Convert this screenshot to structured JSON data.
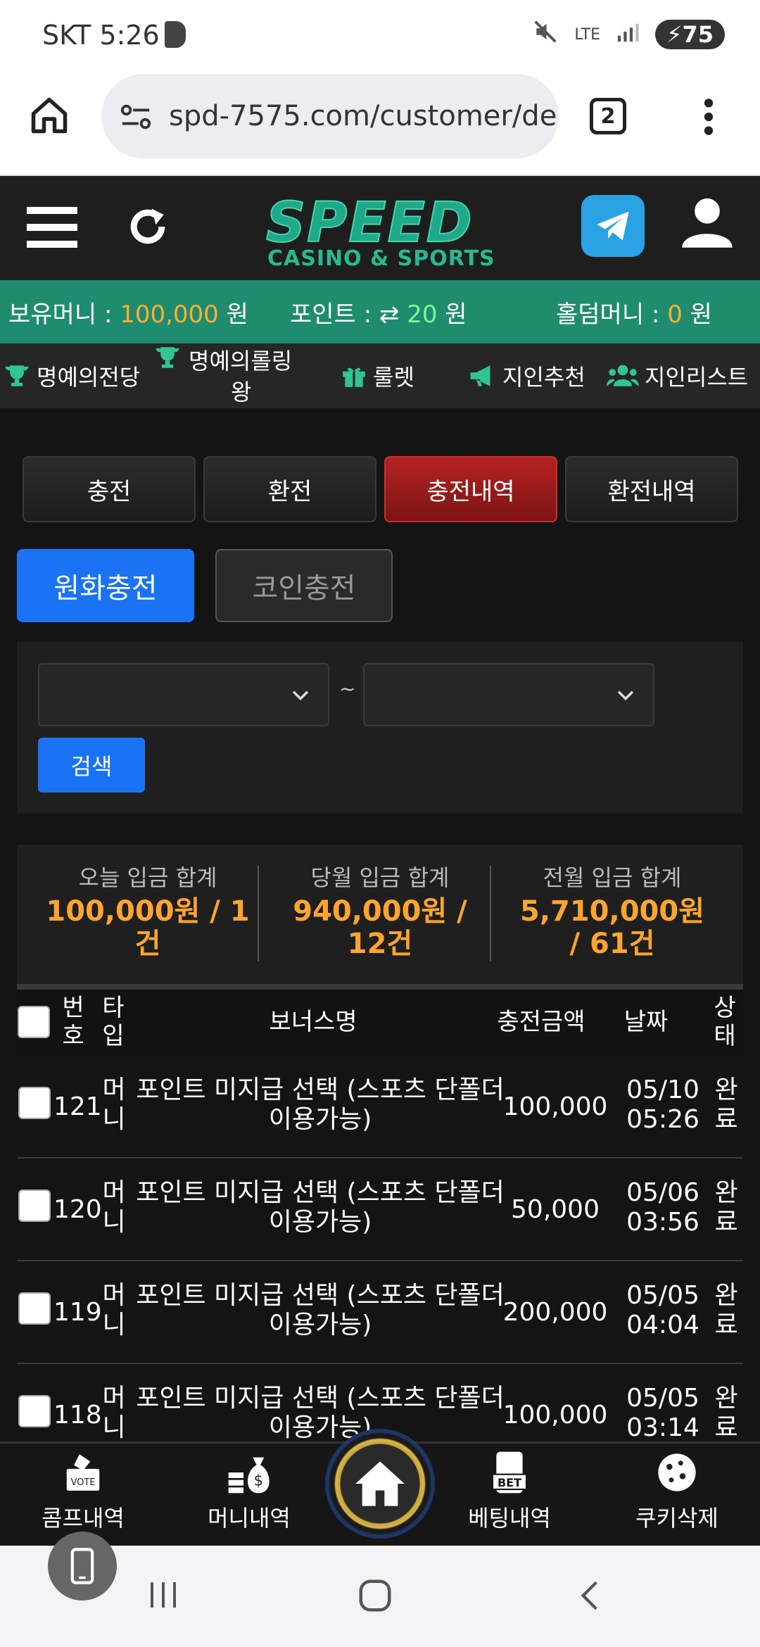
{
  "status_bar": {
    "carrier_time": "SKT 5:26",
    "network": "LTE",
    "battery": "75"
  },
  "browser": {
    "url": "spd-7575.com/customer/de",
    "tab_count": "2"
  },
  "logo": {
    "main": "SPEED",
    "sub": "CASINO & SPORTS"
  },
  "money_bar": {
    "holding_label": "보유머니 : ",
    "holding_value": "100,000",
    "holding_unit": " 원",
    "point_label": "포인트 : ",
    "point_value": "20",
    "point_unit": " 원",
    "holdem_label": "홀덤머니 : ",
    "holdem_value": "0",
    "holdem_unit": " 원"
  },
  "menu": {
    "hall_of_fame": "명예의전당",
    "rolling_king_1": "명예의롤링",
    "rolling_king_2": "왕",
    "roulette": "룰렛",
    "referral": "지인추천",
    "referral_list": "지인리스트"
  },
  "tabs": [
    "충전",
    "환전",
    "충전내역",
    "환전내역"
  ],
  "sub_tabs": {
    "krw": "원화충전",
    "coin": "코인충전"
  },
  "search": {
    "tilde": "~",
    "button": "검색"
  },
  "summary": [
    {
      "label": "오늘 입금 합계",
      "value": "100,000원 / 1건"
    },
    {
      "label": "당월 입금 합계",
      "value": "940,000원 / 12건"
    },
    {
      "label": "전월 입금 합계",
      "value": "5,710,000원 / 61건"
    }
  ],
  "table": {
    "headers": {
      "no_1": "번",
      "no_2": "호",
      "type_1": "타",
      "type_2": "입",
      "bonus": "보너스명",
      "amount": "충전금액",
      "date": "날짜",
      "status_1": "상",
      "status_2": "태"
    },
    "rows": [
      {
        "no": "121",
        "type_1": "머",
        "type_2": "니",
        "bonus_1": "포인트 미지급 선택 (스포츠 단폴더",
        "bonus_2": "이용가능)",
        "amount": "100,000",
        "date": "05/10",
        "time": "05:26",
        "status_1": "완",
        "status_2": "료"
      },
      {
        "no": "120",
        "type_1": "머",
        "type_2": "니",
        "bonus_1": "포인트 미지급 선택 (스포츠 단폴더",
        "bonus_2": "이용가능)",
        "amount": "50,000",
        "date": "05/06",
        "time": "03:56",
        "status_1": "완",
        "status_2": "료"
      },
      {
        "no": "119",
        "type_1": "머",
        "type_2": "니",
        "bonus_1": "포인트 미지급 선택 (스포츠 단폴더",
        "bonus_2": "이용가능)",
        "amount": "200,000",
        "date": "05/05",
        "time": "04:04",
        "status_1": "완",
        "status_2": "료"
      },
      {
        "no": "118",
        "type_1": "머",
        "type_2": "니",
        "bonus_1": "포인트 미지급 선택 (스포츠 단폴더",
        "bonus_2": "이용가능)",
        "amount": "100,000",
        "date": "05/05",
        "time": "03:14",
        "status_1": "완",
        "status_2": "료"
      }
    ]
  },
  "bottom_nav": {
    "comp": "콤프내역",
    "money": "머니내역",
    "betting": "베팅내역",
    "cookie": "쿠키삭제",
    "bet_badge": "BET",
    "vote_badge": "VOTE"
  }
}
